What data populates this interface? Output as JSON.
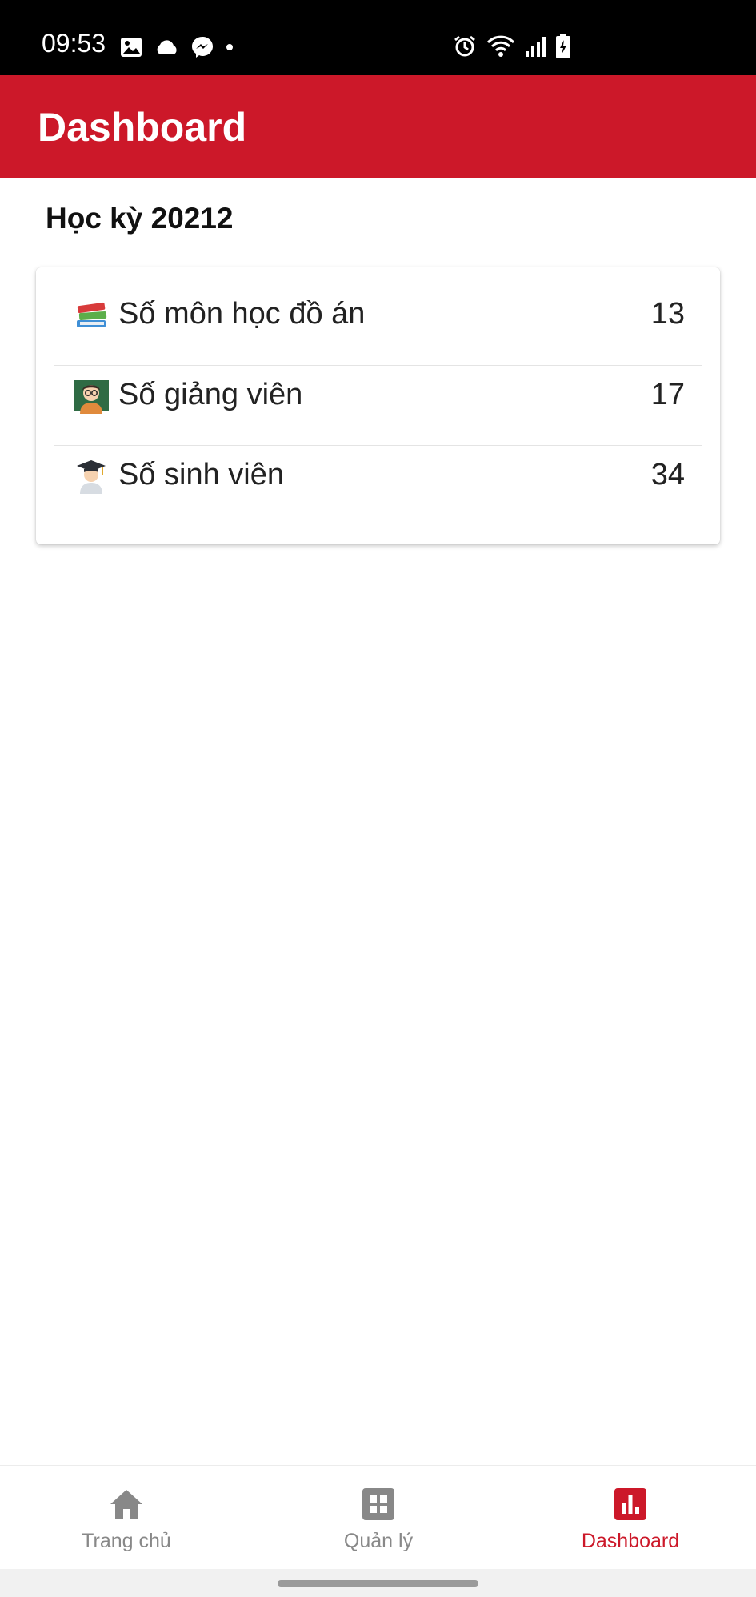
{
  "status_bar": {
    "time": "09:53",
    "left_icons": [
      "image-icon",
      "cloud-icon",
      "messenger-icon",
      "dot-icon"
    ],
    "right_icons": [
      "alarm-icon",
      "wifi-icon",
      "signal-icon",
      "battery-charging-icon"
    ]
  },
  "app_bar": {
    "title": "Dashboard",
    "color": "#cc1829"
  },
  "main": {
    "semester_title": "Học kỳ 20212",
    "stats": [
      {
        "icon": "books-emoji-icon",
        "label": "Số môn học đồ án",
        "value": "13"
      },
      {
        "icon": "teacher-emoji-icon",
        "label": "Số giảng viên",
        "value": "17"
      },
      {
        "icon": "student-emoji-icon",
        "label": "Số sinh viên",
        "value": "34"
      }
    ]
  },
  "bottom_nav": {
    "items": [
      {
        "icon": "home-icon",
        "label": "Trang chủ",
        "active": false
      },
      {
        "icon": "grid-icon",
        "label": "Quản lý",
        "active": false
      },
      {
        "icon": "bar-chart-icon",
        "label": "Dashboard",
        "active": true
      }
    ],
    "active_color": "#cc1829",
    "inactive_color": "#888888"
  }
}
